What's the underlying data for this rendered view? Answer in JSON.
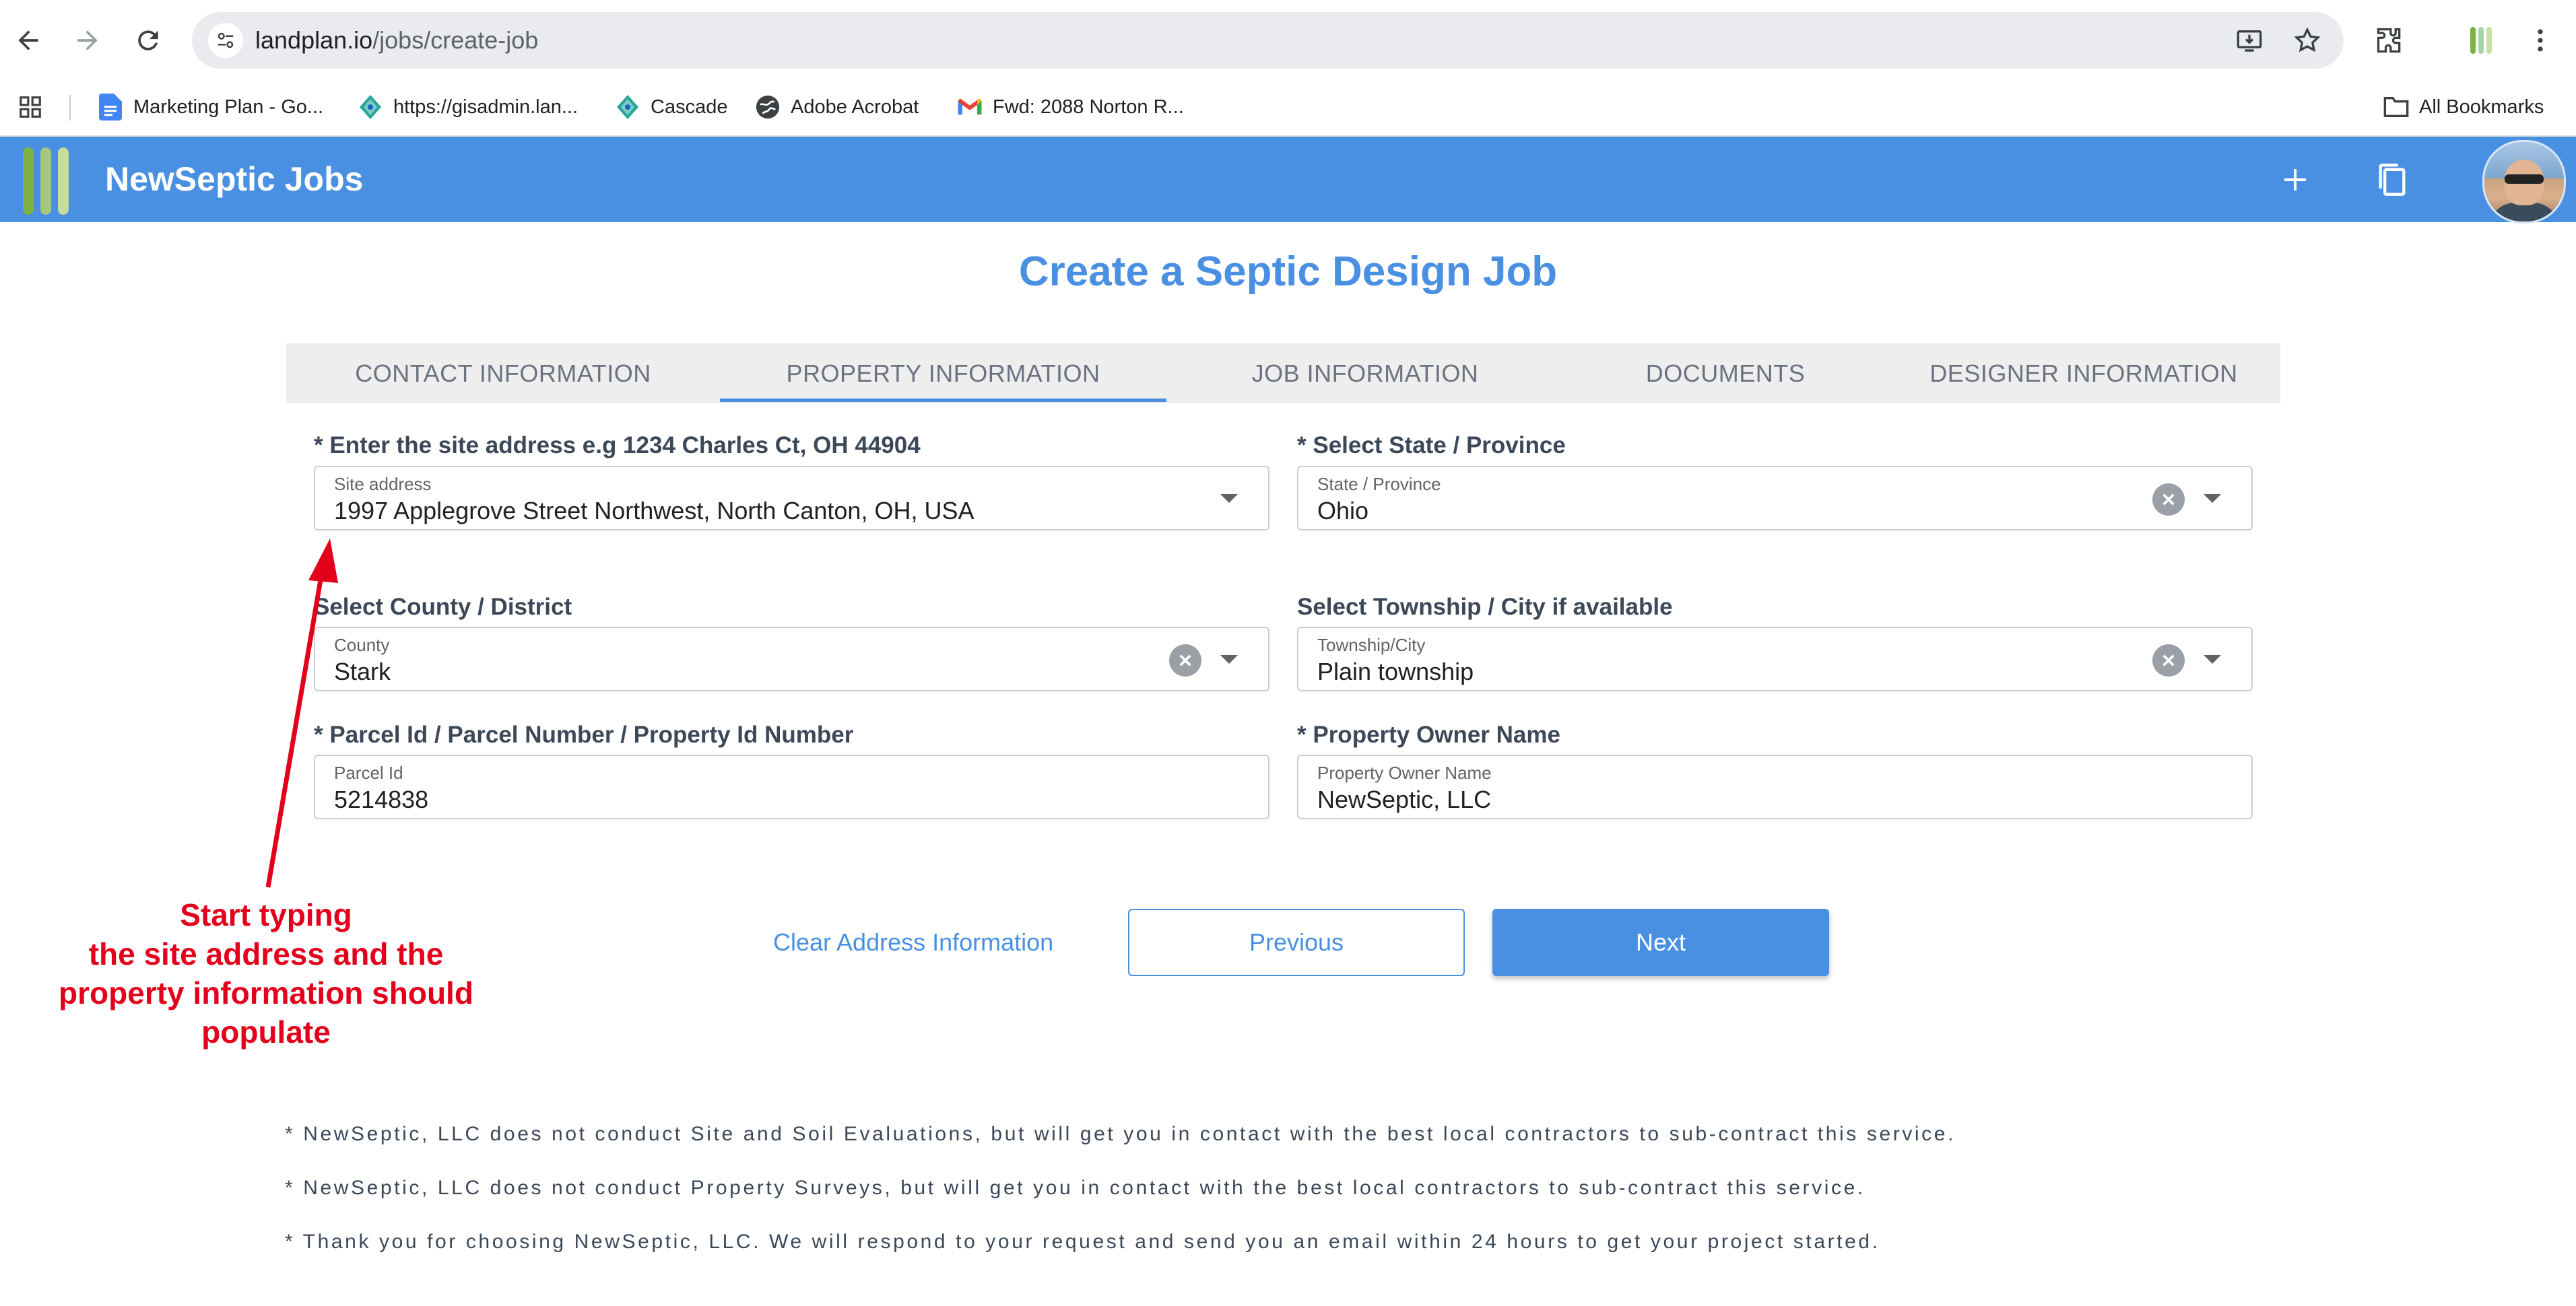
{
  "browser": {
    "url_host": "landplan.io",
    "url_path": "/jobs/create-job",
    "bookmarks": [
      {
        "label": "Marketing Plan - Go...",
        "icon": "google-docs-icon"
      },
      {
        "label": "https://gisadmin.lan...",
        "icon": "globe-gis-icon"
      },
      {
        "label": "Cascade",
        "icon": "globe-gis-icon"
      },
      {
        "label": "Adobe Acrobat",
        "icon": "globe-icon"
      },
      {
        "label": "Fwd: 2088 Norton R...",
        "icon": "gmail-icon"
      }
    ],
    "all_bookmarks": "All Bookmarks"
  },
  "app": {
    "title": "NewSeptic Jobs",
    "brand_color": "#4a90e2"
  },
  "page": {
    "title": "Create a Septic Design Job",
    "tabs": [
      {
        "label": "CONTACT INFORMATION"
      },
      {
        "label": "PROPERTY INFORMATION",
        "active": true
      },
      {
        "label": "JOB INFORMATION"
      },
      {
        "label": "DOCUMENTS"
      },
      {
        "label": "DESIGNER INFORMATION"
      }
    ]
  },
  "form": {
    "site_address": {
      "heading": "* Enter the site address e.g 1234 Charles Ct, OH 44904",
      "label": "Site address",
      "value": "1997 Applegrove Street Northwest, North Canton, OH, USA"
    },
    "state": {
      "heading": "* Select State / Province",
      "label": "State / Province",
      "value": "Ohio"
    },
    "county": {
      "heading": "Select County / District",
      "label": "County",
      "value": "Stark"
    },
    "township": {
      "heading": "Select Township / City if available",
      "label": "Township/City",
      "value": "Plain township"
    },
    "parcel": {
      "heading": "* Parcel Id / Parcel Number / Property Id Number",
      "label": "Parcel Id",
      "value": "5214838"
    },
    "owner": {
      "heading": "* Property Owner Name",
      "label": "Property Owner Name",
      "value": "NewSeptic, LLC"
    }
  },
  "actions": {
    "clear": "Clear Address Information",
    "previous": "Previous",
    "next": "Next"
  },
  "notes": [
    "* NewSeptic, LLC does not conduct Site and Soil Evaluations, but will get you in contact with the best local contractors to sub-contract this service.",
    "* NewSeptic, LLC does not conduct Property Surveys, but will get you in contact with the best local contractors to sub-contract this service.",
    "* Thank you for choosing NewSeptic, LLC. We will respond to your request and send you an email within 24 hours to get your project started."
  ],
  "annotation": {
    "lines": [
      "Start typing",
      "the site address and the",
      "property information should",
      "populate"
    ],
    "color": "#e3001b"
  }
}
